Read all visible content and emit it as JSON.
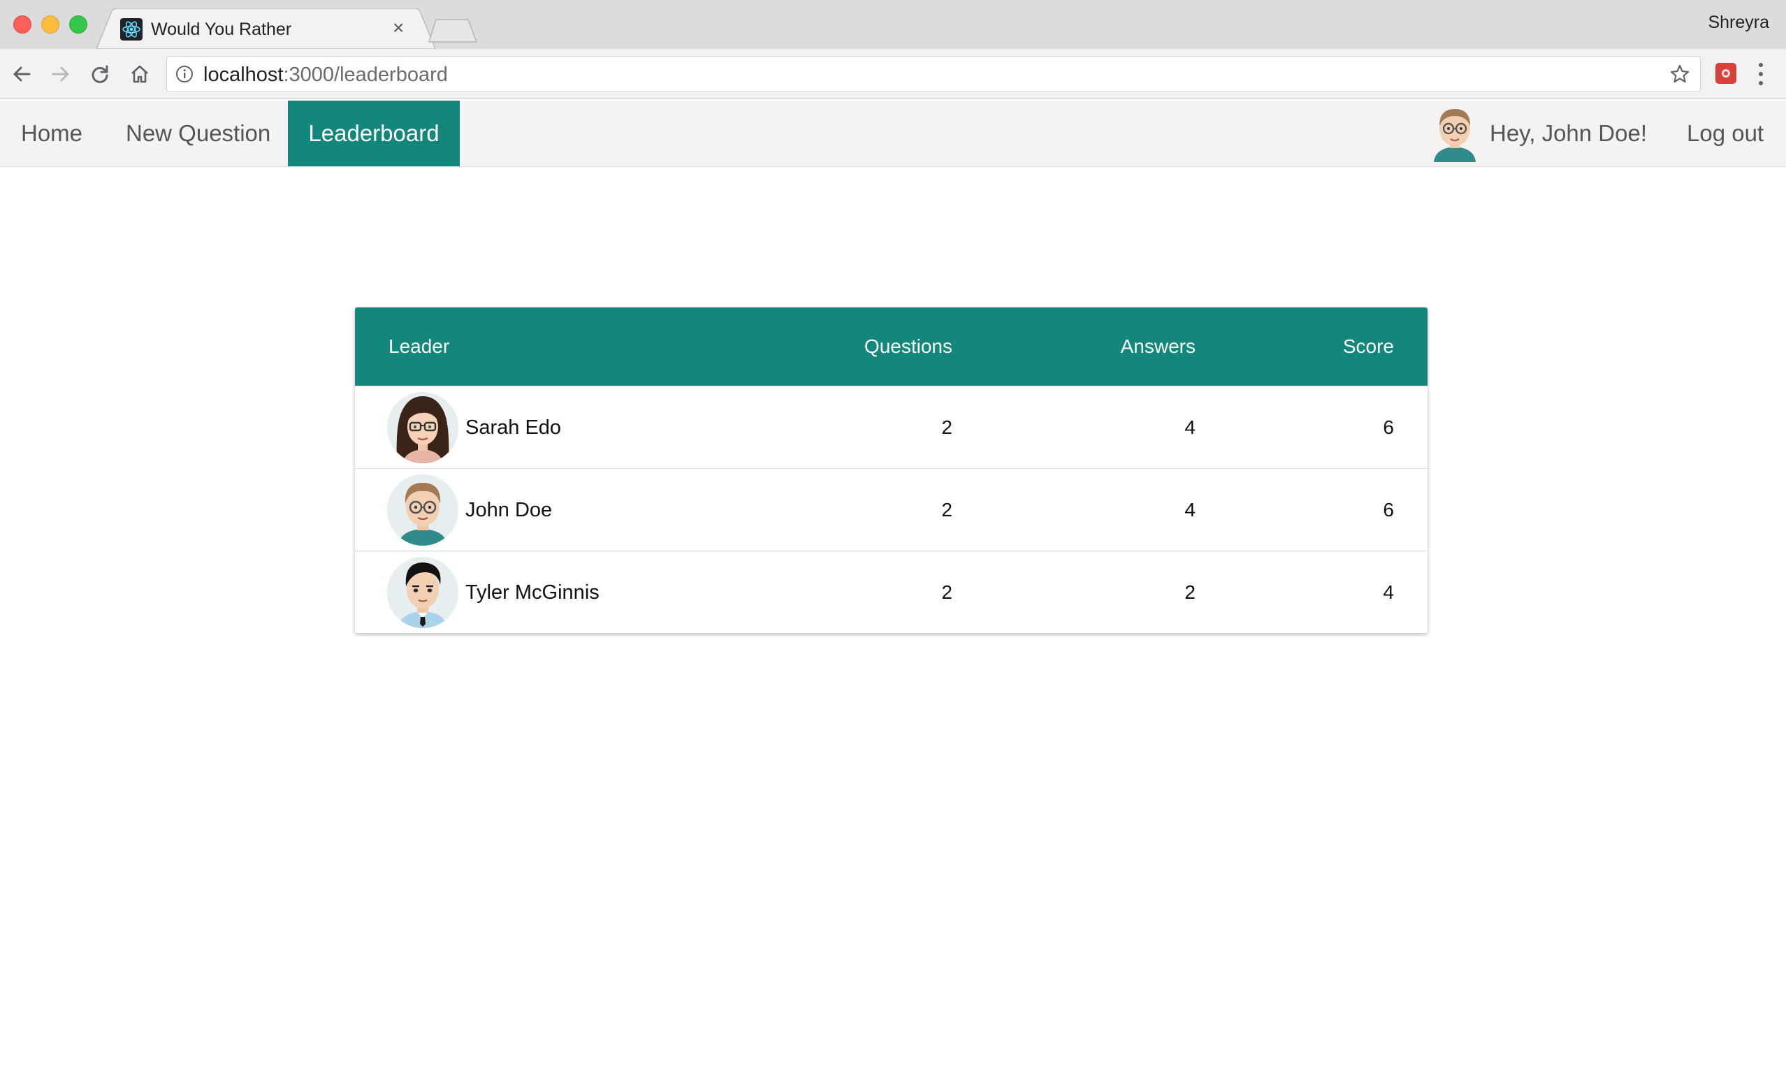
{
  "browser": {
    "tab_title": "Would You Rather",
    "tab_close": "×",
    "profile_name": "Shreyra",
    "url_host": "localhost",
    "url_path": ":3000/leaderboard",
    "icons": [
      "back-icon",
      "forward-icon",
      "reload-icon",
      "home-icon",
      "info-icon",
      "star-icon",
      "extension-icon",
      "menu-icon",
      "react-icon"
    ]
  },
  "nav": {
    "home": "Home",
    "new_question": "New Question",
    "leaderboard": "Leaderboard",
    "greeting": "Hey, John Doe!",
    "logout": "Log out",
    "active_tab": "Leaderboard"
  },
  "leaderboard": {
    "headers": {
      "leader": "Leader",
      "questions": "Questions",
      "answers": "Answers",
      "score": "Score"
    },
    "rows": [
      {
        "name": "Sarah Edo",
        "questions": "2",
        "answers": "4",
        "score": "6",
        "avatar": "female-glasses-avatar"
      },
      {
        "name": "John Doe",
        "questions": "2",
        "answers": "4",
        "score": "6",
        "avatar": "male-glasses-avatar"
      },
      {
        "name": "Tyler McGinnis",
        "questions": "2",
        "answers": "2",
        "score": "4",
        "avatar": "male-tie-avatar"
      }
    ]
  },
  "colors": {
    "accent": "#13877b",
    "nav_bg": "#f3f3f3",
    "chrome_bg": "#dcdcdc"
  }
}
